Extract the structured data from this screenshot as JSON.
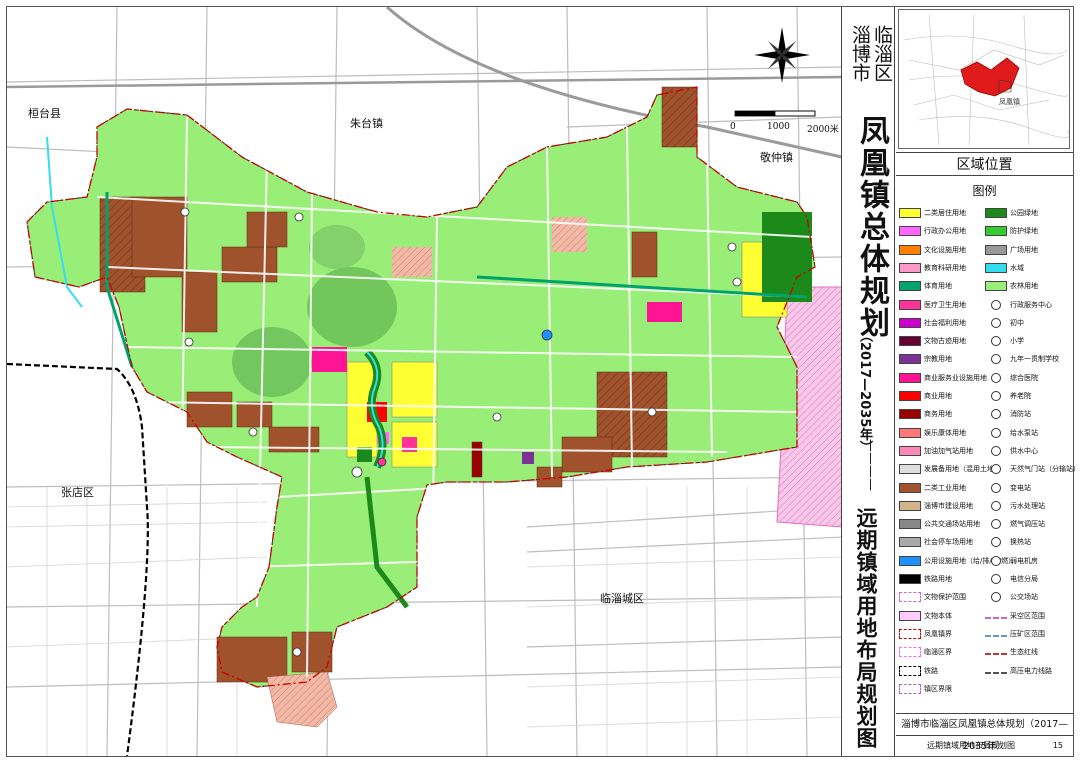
{
  "title": {
    "city": "淄博市",
    "county": "临淄区",
    "main": "凤凰镇总体规划",
    "years": "（2017—2035年）",
    "dash": "————",
    "subtitle": "远期镇域用地布局规划图"
  },
  "place_names": {
    "huantai": "桓台县",
    "zhutai": "朱台镇",
    "jingzhong": "敬仲镇",
    "zhangdian": "张店区",
    "linzi": "临淄城区"
  },
  "scale_bar": {
    "ticks": [
      "0",
      "1000",
      "2000米"
    ]
  },
  "location_map": {
    "caption": "区域位置",
    "highlight_label": "凤凰镇"
  },
  "legend": {
    "title": "图例",
    "left": [
      {
        "label": "二类居住用地",
        "color": "#ffff33"
      },
      {
        "label": "行政办公用地",
        "color": "#ff66ff"
      },
      {
        "label": "文化设施用地",
        "color": "#ff7f00"
      },
      {
        "label": "教育科研用地",
        "color": "#ff99cc"
      },
      {
        "label": "体育用地",
        "color": "#00a36c"
      },
      {
        "label": "医疗卫生用地",
        "color": "#ff3399"
      },
      {
        "label": "社会福利用地",
        "color": "#cc00cc"
      },
      {
        "label": "文物古迹用地",
        "color": "#660033"
      },
      {
        "label": "宗教用地",
        "color": "#7b3294"
      },
      {
        "label": "商业服务业设施用地",
        "color": "#ff1493"
      },
      {
        "label": "商业用地",
        "color": "#ff0000"
      },
      {
        "label": "商务用地",
        "color": "#990000"
      },
      {
        "label": "娱乐康体用地",
        "color": "#ff7777"
      },
      {
        "label": "加油加气站用地",
        "color": "#ff88bb"
      },
      {
        "label": "发展备用地（混用土地）",
        "color": "#dddddd"
      },
      {
        "label": "二类工业用地",
        "color": "#a0522d"
      },
      {
        "label": "淄博市建设用地",
        "color": "#d2b48c"
      },
      {
        "label": "公共交通场站用地",
        "color": "#888888"
      },
      {
        "label": "社会停车场用地",
        "color": "#aaaaaa"
      },
      {
        "label": "公用设施用地（给/排/电/燃）",
        "color": "#1e90ff"
      },
      {
        "label": "铁路用地",
        "color": "#000000"
      },
      {
        "label": "文物保护范围",
        "color": "#ffffff",
        "line": "#cc66cc"
      },
      {
        "label": "文物本体",
        "color": "#ffccff"
      },
      {
        "label": "凤凰镇界",
        "color": "#ffffff",
        "line": "#cc0000"
      },
      {
        "label": "临淄区界",
        "color": "#ffffff",
        "line": "#ff66ff"
      },
      {
        "label": "铁路",
        "color": "#ffffff",
        "line": "#000000"
      },
      {
        "label": "镇区界限",
        "color": "#ffffff",
        "line": "#aa66cc"
      }
    ],
    "right": [
      {
        "label": "公园绿地",
        "color": "#1b8a1b"
      },
      {
        "label": "防护绿地",
        "color": "#33cc33"
      },
      {
        "label": "广场用地",
        "color": "#999999"
      },
      {
        "label": "水域",
        "color": "#33ddee"
      },
      {
        "label": "农林用地",
        "color": "#99ee77"
      },
      {
        "label": "行政服务中心",
        "icon": "admin-center-icon"
      },
      {
        "label": "初中",
        "icon": "middle-school-icon"
      },
      {
        "label": "小学",
        "icon": "primary-school-icon"
      },
      {
        "label": "九年一贯制学校",
        "icon": "nine-year-school-icon"
      },
      {
        "label": "综合医院",
        "icon": "hospital-icon"
      },
      {
        "label": "养老院",
        "icon": "nursing-home-icon"
      },
      {
        "label": "消防站",
        "icon": "fire-station-icon"
      },
      {
        "label": "给水泵站",
        "icon": "pump-station-icon"
      },
      {
        "label": "供水中心",
        "icon": "water-supply-icon"
      },
      {
        "label": "天然气门站（分输站）",
        "icon": "gas-gate-icon"
      },
      {
        "label": "变电站",
        "icon": "substation-icon"
      },
      {
        "label": "污水处理站",
        "icon": "sewage-icon"
      },
      {
        "label": "燃气调压站",
        "icon": "gas-regulator-icon"
      },
      {
        "label": "换热站",
        "icon": "heat-exchange-icon"
      },
      {
        "label": "弱电机房",
        "icon": "telecom-room-icon"
      },
      {
        "label": "电信分局",
        "icon": "telecom-branch-icon"
      },
      {
        "label": "公交场站",
        "icon": "bus-station-icon"
      },
      {
        "label": "采空区范围",
        "line": "#cc66cc"
      },
      {
        "label": "压矿区范围",
        "line": "#6699cc"
      },
      {
        "label": "生态红线",
        "line": "#cc3333"
      },
      {
        "label": "高压电力线路",
        "line": "#555555"
      }
    ]
  },
  "footer": {
    "title": "淄博市临淄区凤凰镇总体规划（2017—2035年）",
    "sheet_name": "远期镇域用地布局规划图",
    "page": "15"
  },
  "colors": {
    "farmland": "#99ee77",
    "industrial": "#a0522d",
    "residential": "#ffff33",
    "green": "#1b8a1b",
    "road": "#bbbbbb"
  }
}
